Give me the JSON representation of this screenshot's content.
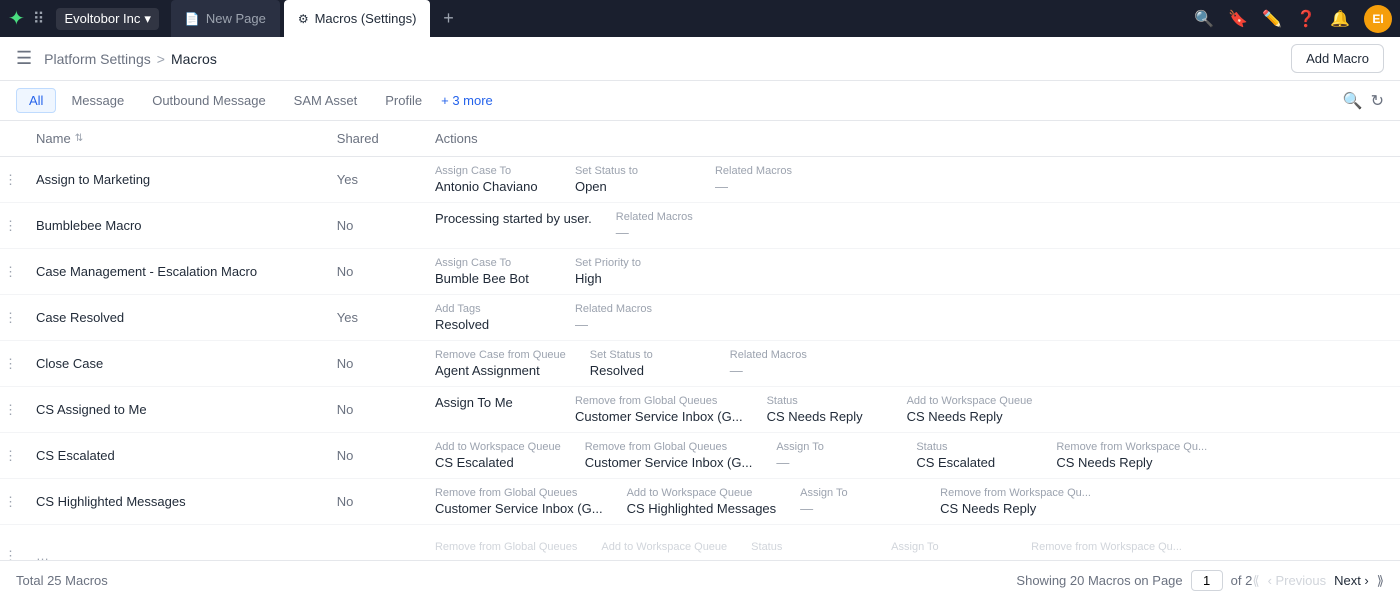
{
  "topNav": {
    "logo": "✦",
    "grid_icon": "⋮⋮⋮",
    "brand": "Evoltobor Inc",
    "brand_caret": "▾",
    "tabs": [
      {
        "id": "new-page",
        "label": "New Page",
        "icon": "📄",
        "active": false
      },
      {
        "id": "macros-settings",
        "label": "Macros (Settings)",
        "icon": "⚙",
        "active": true
      }
    ],
    "tab_add": "+",
    "icons": {
      "search": "🔍",
      "bookmark": "🔖",
      "edit": "✏",
      "help": "❓",
      "bell": "🔔"
    },
    "avatar_label": "EI"
  },
  "subNav": {
    "menu_icon": "☰",
    "breadcrumb": [
      {
        "label": "Platform Settings",
        "link": true
      },
      {
        "label": "Macros",
        "link": false
      }
    ],
    "sep": ">",
    "add_macro_label": "Add Macro"
  },
  "filterTabs": {
    "tabs": [
      {
        "id": "all",
        "label": "All",
        "active": true
      },
      {
        "id": "message",
        "label": "Message",
        "active": false
      },
      {
        "id": "outbound-message",
        "label": "Outbound Message",
        "active": false
      },
      {
        "id": "sam-asset",
        "label": "SAM Asset",
        "active": false
      },
      {
        "id": "profile",
        "label": "Profile",
        "active": false
      }
    ],
    "more_label": "+ 3 more"
  },
  "table": {
    "columns": [
      {
        "id": "dots",
        "label": ""
      },
      {
        "id": "name",
        "label": "Name",
        "sortable": true
      },
      {
        "id": "shared",
        "label": "Shared"
      },
      {
        "id": "actions",
        "label": "Actions"
      }
    ],
    "rows": [
      {
        "name": "Assign to Marketing",
        "shared": "Yes",
        "actions": [
          {
            "label": "Assign Case To",
            "value": "Antonio Chaviano"
          },
          {
            "label": "Set Status to",
            "value": "Open"
          },
          {
            "label": "Related Macros",
            "value": "—"
          }
        ]
      },
      {
        "name": "Bumblebee Macro",
        "shared": "No",
        "actions": [
          {
            "label": "",
            "value": "Processing started by user."
          },
          {
            "label": "Related Macros",
            "value": "—"
          }
        ]
      },
      {
        "name": "Case Management - Escalation Macro",
        "shared": "No",
        "actions": [
          {
            "label": "Assign Case To",
            "value": "Bumble Bee Bot"
          },
          {
            "label": "Set Priority to",
            "value": "High"
          }
        ]
      },
      {
        "name": "Case Resolved",
        "shared": "Yes",
        "actions": [
          {
            "label": "Add Tags",
            "value": "Resolved"
          },
          {
            "label": "Related Macros",
            "value": "—"
          }
        ]
      },
      {
        "name": "Close Case",
        "shared": "No",
        "actions": [
          {
            "label": "Remove Case from Queue",
            "value": "Agent Assignment"
          },
          {
            "label": "Set Status to",
            "value": "Resolved"
          },
          {
            "label": "Related Macros",
            "value": "—"
          }
        ]
      },
      {
        "name": "CS Assigned to Me",
        "shared": "No",
        "actions": [
          {
            "label": "",
            "value": "Assign To Me"
          },
          {
            "label": "Remove from Global Queues",
            "value": "Customer Service Inbox (G..."
          },
          {
            "label": "Status",
            "value": "CS Needs Reply"
          },
          {
            "label": "Add to Workspace Queue",
            "value": "CS Needs Reply"
          }
        ]
      },
      {
        "name": "CS Escalated",
        "shared": "No",
        "actions": [
          {
            "label": "Add to Workspace Queue",
            "value": "CS Escalated"
          },
          {
            "label": "Remove from Global Queues",
            "value": "Customer Service Inbox (G..."
          },
          {
            "label": "Assign To",
            "value": "—"
          },
          {
            "label": "Status",
            "value": "CS Escalated"
          },
          {
            "label": "Remove from Workspace Qu...",
            "value": "CS Needs Reply"
          }
        ]
      },
      {
        "name": "CS Highlighted Messages",
        "shared": "No",
        "actions": [
          {
            "label": "Remove from Global Queues",
            "value": "Customer Service Inbox (G..."
          },
          {
            "label": "Add to Workspace Queue",
            "value": "CS Highlighted Messages"
          },
          {
            "label": "Assign To",
            "value": "—"
          },
          {
            "label": "Remove from Workspace Qu...",
            "value": "CS Needs Reply"
          }
        ]
      },
      {
        "name": "...",
        "shared": "",
        "actions": [
          {
            "label": "Remove from Global Queues",
            "value": ""
          },
          {
            "label": "Add to Workspace Queue",
            "value": ""
          },
          {
            "label": "Status",
            "value": ""
          },
          {
            "label": "Assign To",
            "value": ""
          },
          {
            "label": "Remove from Workspace Qu...",
            "value": ""
          }
        ]
      }
    ]
  },
  "footer": {
    "total_label": "Total 25 Macros",
    "showing_label": "Showing 20 Macros on Page",
    "current_page": "1",
    "of_label": "of 2",
    "first_btn": "⟨⟨",
    "prev_btn": "‹ Previous",
    "next_btn": "Next ›",
    "last_btn": "⟩⟩"
  }
}
